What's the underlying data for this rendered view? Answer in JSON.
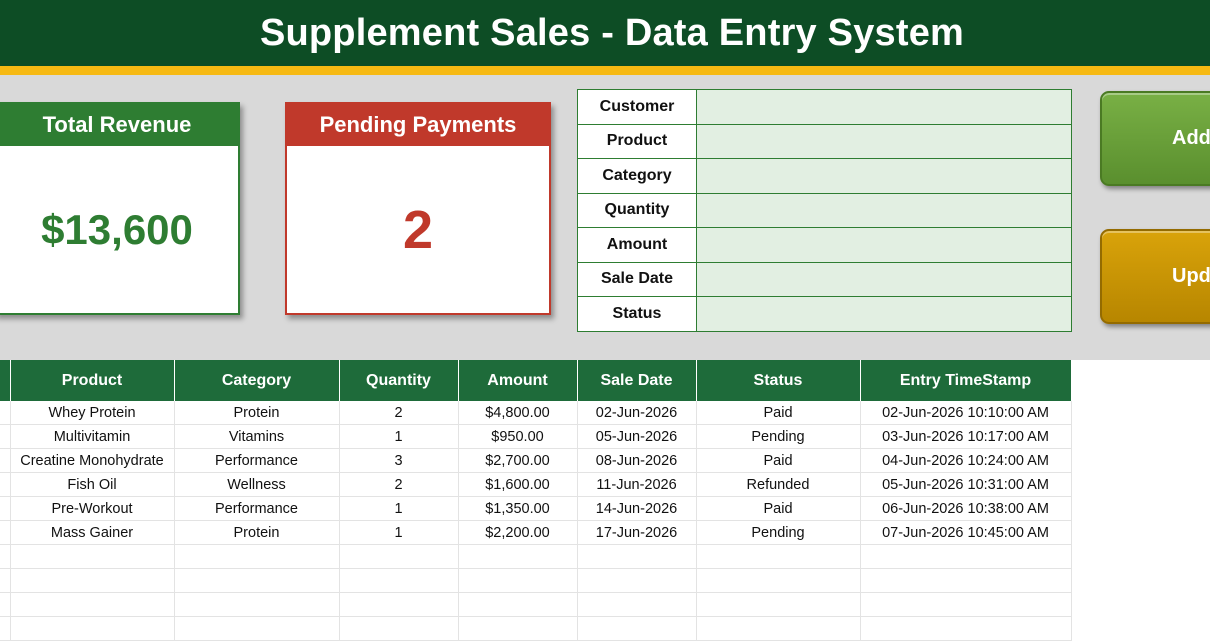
{
  "title": "Supplement Sales - Data Entry System",
  "cards": {
    "revenue": {
      "label": "Total Revenue",
      "value": "$13,600"
    },
    "pending": {
      "label": "Pending Payments",
      "value": "2"
    }
  },
  "form": {
    "fields": [
      {
        "label": "Customer",
        "value": ""
      },
      {
        "label": "Product",
        "value": ""
      },
      {
        "label": "Category",
        "value": ""
      },
      {
        "label": "Quantity",
        "value": ""
      },
      {
        "label": "Amount",
        "value": ""
      },
      {
        "label": "Sale Date",
        "value": ""
      },
      {
        "label": "Status",
        "value": ""
      }
    ]
  },
  "buttons": {
    "add_label": "Add",
    "update_label": "Updat"
  },
  "table": {
    "columns": [
      "",
      "Product",
      "Category",
      "Quantity",
      "Amount",
      "Sale Date",
      "Status",
      "Entry TimeStamp"
    ],
    "rows": [
      [
        "",
        "Whey Protein",
        "Protein",
        "2",
        "$4,800.00",
        "02-Jun-2026",
        "Paid",
        "02-Jun-2026 10:10:00 AM"
      ],
      [
        "",
        "Multivitamin",
        "Vitamins",
        "1",
        "$950.00",
        "05-Jun-2026",
        "Pending",
        "03-Jun-2026 10:17:00 AM"
      ],
      [
        "",
        "Creatine Monohydrate",
        "Performance",
        "3",
        "$2,700.00",
        "08-Jun-2026",
        "Paid",
        "04-Jun-2026 10:24:00 AM"
      ],
      [
        "",
        "Fish Oil",
        "Wellness",
        "2",
        "$1,600.00",
        "11-Jun-2026",
        "Refunded",
        "05-Jun-2026 10:31:00 AM"
      ],
      [
        "",
        "Pre-Workout",
        "Performance",
        "1",
        "$1,350.00",
        "14-Jun-2026",
        "Paid",
        "06-Jun-2026 10:38:00 AM"
      ],
      [
        "",
        "Mass Gainer",
        "Protein",
        "1",
        "$2,200.00",
        "17-Jun-2026",
        "Pending",
        "07-Jun-2026 10:45:00 AM"
      ]
    ],
    "empty_rows": 4
  }
}
